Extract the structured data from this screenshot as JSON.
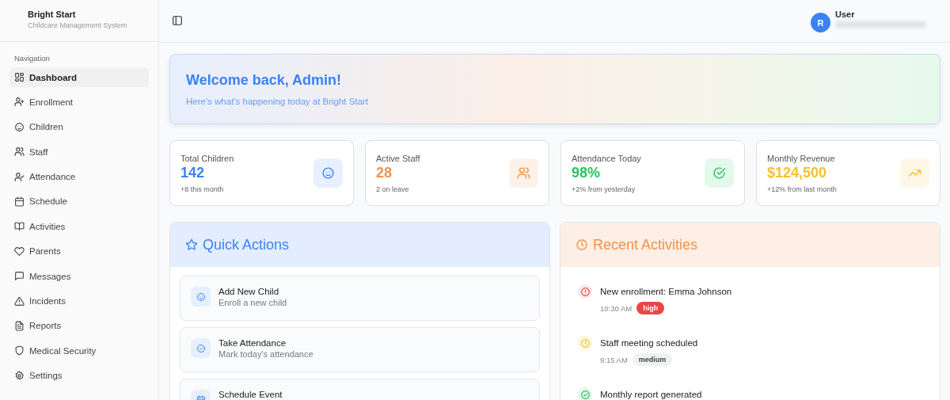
{
  "brand": {
    "title": "Bright Start",
    "subtitle": "Childcare Management System"
  },
  "sidebar": {
    "heading": "Navigation",
    "items": [
      {
        "label": "Dashboard",
        "selected": true
      },
      {
        "label": "Enrollment",
        "selected": false
      },
      {
        "label": "Children",
        "selected": false
      },
      {
        "label": "Staff",
        "selected": false
      },
      {
        "label": "Attendance",
        "selected": false
      },
      {
        "label": "Schedule",
        "selected": false
      },
      {
        "label": "Activities",
        "selected": false
      },
      {
        "label": "Parents",
        "selected": false
      },
      {
        "label": "Messages",
        "selected": false
      },
      {
        "label": "Incidents",
        "selected": false
      },
      {
        "label": "Reports",
        "selected": false
      },
      {
        "label": "Medical Security",
        "selected": false
      },
      {
        "label": "Settings",
        "selected": false
      }
    ]
  },
  "user": {
    "initial": "R",
    "name": "User"
  },
  "welcome": {
    "title": "Welcome back, Admin!",
    "subtitle": "Here's what's happening today at Bright Start"
  },
  "stats": [
    {
      "label": "Total Children",
      "value": "142",
      "note": "+8 this month",
      "color": "#3b82f6"
    },
    {
      "label": "Active Staff",
      "value": "28",
      "note": "2 on leave",
      "color": "#f2914a"
    },
    {
      "label": "Attendance Today",
      "value": "98%",
      "note": "+2% from yesterday",
      "color": "#22c55e"
    },
    {
      "label": "Monthly Revenue",
      "value": "$124,500",
      "note": "+12% from last month",
      "color": "#f5c12e"
    }
  ],
  "quick_actions": {
    "title": "Quick Actions",
    "items": [
      {
        "title": "Add New Child",
        "subtitle": "Enroll a new child"
      },
      {
        "title": "Take Attendance",
        "subtitle": "Mark today's attendance"
      },
      {
        "title": "Schedule Event"
      }
    ]
  },
  "recent_activities": {
    "title": "Recent Activities",
    "items": [
      {
        "kind": "alert",
        "title": "New enrollment: Emma Johnson",
        "time": "10:30 AM",
        "priority": "high"
      },
      {
        "kind": "clock",
        "title": "Staff meeting scheduled",
        "time": "9:15 AM",
        "priority": "medium"
      },
      {
        "kind": "check",
        "title": "Monthly report generated"
      }
    ]
  }
}
